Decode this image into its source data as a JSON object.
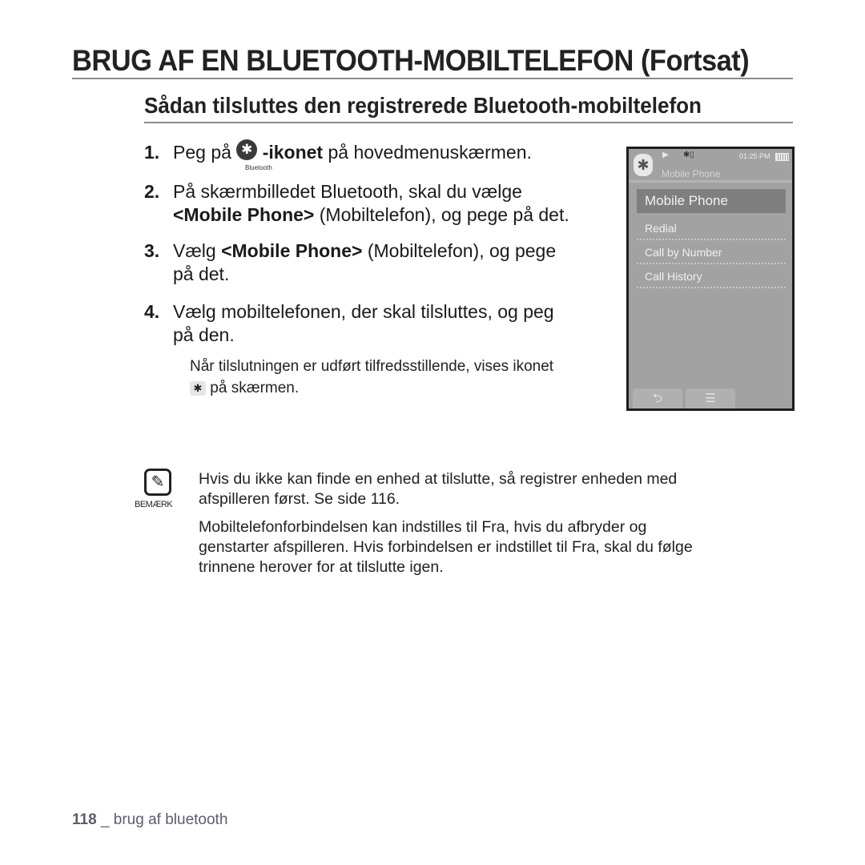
{
  "header": {
    "title": "BRUG AF EN BLUETOOTH-MOBILTELEFON (Fortsat)",
    "section_title": "Sådan tilsluttes den registrerede Bluetooth-mobiltelefon"
  },
  "steps": [
    {
      "num": "1.",
      "pre": "Peg på",
      "icon": "bluetooth-icon",
      "icon_caption": "Bluetooth",
      "bold": "-ikonet",
      "post": " på hovedmenuskærmen."
    },
    {
      "num": "2.",
      "line1": "På skærmbilledet Bluetooth, skal du vælge",
      "bold": "<Mobile Phone>",
      "post": " (Mobiltelefon), og pege på det."
    },
    {
      "num": "3.",
      "pre": "Vælg ",
      "bold": "<Mobile Phone>",
      "post": " (Mobiltelefon), og pege",
      "line2": "på det."
    },
    {
      "num": "4.",
      "line1": "Vælg mobiltelefonen, der skal tilsluttes, og peg",
      "line2": "på den."
    }
  ],
  "result_note": {
    "line1": "Når tilslutningen er udført tilfredsstillende, vises ikonet",
    "line2": "på skærmen.",
    "icon": "bluetooth-connected-icon"
  },
  "device": {
    "time": "01:25 PM",
    "subtitle": "Mobile Phone",
    "selected_item": "Mobile Phone",
    "items": [
      "Redial",
      "Call by Number",
      "Call History"
    ],
    "buttons": [
      "back-icon",
      "menu-icon"
    ]
  },
  "note": {
    "label": "BEMÆRK",
    "paragraphs": [
      [
        "Hvis du ikke kan finde en enhed at tilslutte, så registrer enheden med",
        "afspilleren først. Se side 116."
      ],
      [
        "Mobiltelefonforbindelsen kan indstilles til Fra, hvis du afbryder og",
        "genstarter afspilleren. Hvis forbindelsen er indstillet til Fra, skal du følge",
        "trinnene herover for at tilslutte igen."
      ]
    ]
  },
  "footer": {
    "page_number": "118",
    "separator": " _ ",
    "section": "brug af bluetooth"
  }
}
